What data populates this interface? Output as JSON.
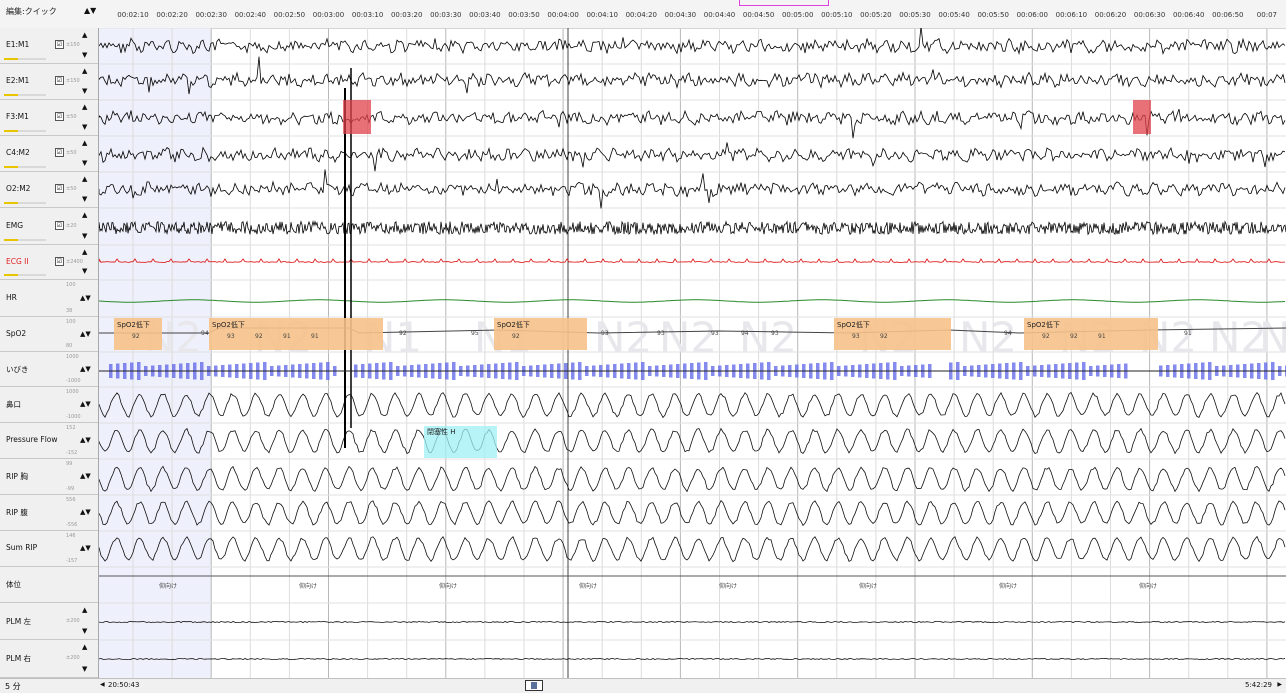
{
  "toolbar": {
    "edit_mode": "編集:クイック",
    "arrows": "▲▼"
  },
  "timeline": [
    "00:02:10",
    "00:02:20",
    "00:02:30",
    "00:02:40",
    "00:02:50",
    "00:03:00",
    "00:03:10",
    "00:03:20",
    "00:03:30",
    "00:03:40",
    "00:03:50",
    "00:04:00",
    "00:04:10",
    "00:04:20",
    "00:04:30",
    "00:04:40",
    "00:04:50",
    "00:05:00",
    "00:05:10",
    "00:05:20",
    "00:05:30",
    "00:05:40",
    "00:05:50",
    "00:06:00",
    "00:06:10",
    "00:06:20",
    "00:06:30",
    "00:06:40",
    "00:06:50",
    "00:07"
  ],
  "channels": [
    {
      "name": "E1:M1",
      "checked": "☑",
      "scale": "±150",
      "kind": "eeg",
      "color": "#000000"
    },
    {
      "name": "E2:M1",
      "checked": "☑",
      "scale": "±150",
      "kind": "eeg",
      "color": "#000000"
    },
    {
      "name": "F3:M1",
      "checked": "☑",
      "scale": "±50",
      "kind": "eeg",
      "color": "#000000"
    },
    {
      "name": "C4:M2",
      "checked": "☑",
      "scale": "±50",
      "kind": "eeg",
      "color": "#000000"
    },
    {
      "name": "O2:M2",
      "checked": "☑",
      "scale": "±50",
      "kind": "eeg",
      "color": "#000000"
    },
    {
      "name": "EMG",
      "checked": "☑",
      "scale": "±20",
      "kind": "emg",
      "color": "#000000"
    },
    {
      "name": "ECG II",
      "checked": "☑",
      "scale": "±2400",
      "kind": "ecg",
      "color": "#e02020"
    },
    {
      "name": "HR",
      "checked": "",
      "scale": "100",
      "scale_b": "",
      "scale_c": "38",
      "kind": "hr",
      "color": "#2a8a2a"
    },
    {
      "name": "SpO2",
      "checked": "",
      "scale": "100",
      "scale_b": "",
      "scale_c": "80",
      "kind": "spo2",
      "color": "#333333"
    },
    {
      "name": "いびき",
      "checked": "",
      "scale": "1000",
      "scale_b": "",
      "scale_c": "-1000",
      "kind": "snore",
      "color": "#3a3ae0"
    },
    {
      "name": "鼻口",
      "checked": "",
      "scale": "1000",
      "scale_b": "",
      "scale_c": "-1000",
      "kind": "resp",
      "color": "#111111"
    },
    {
      "name": "Pressure Flow",
      "checked": "",
      "scale": "152",
      "scale_b": "",
      "scale_c": "-152",
      "kind": "resp",
      "color": "#111111"
    },
    {
      "name": "RIP 胸",
      "checked": "",
      "scale": "99",
      "scale_b": "",
      "scale_c": "-99",
      "kind": "resp",
      "color": "#111111"
    },
    {
      "name": "RIP 腹",
      "checked": "",
      "scale": "556",
      "scale_b": "",
      "scale_c": "-556",
      "kind": "resp",
      "color": "#111111"
    },
    {
      "name": "Sum RIP",
      "checked": "",
      "scale": "146",
      "scale_b": "",
      "scale_c": "-157",
      "kind": "resp",
      "color": "#111111"
    },
    {
      "name": "体位",
      "checked": "",
      "scale": "",
      "kind": "pos",
      "color": "#222222"
    },
    {
      "name": "PLM 左",
      "checked": "",
      "scale": "±200",
      "kind": "plm",
      "color": "#111111"
    },
    {
      "name": "PLM 右",
      "checked": "",
      "scale": "±200",
      "kind": "plm",
      "color": "#111111"
    }
  ],
  "stages": [
    "N2",
    "N2",
    "N1",
    "N1",
    "N2",
    "N2",
    "N2",
    "N2",
    "N2",
    "N2",
    "N2",
    "N2",
    "N1"
  ],
  "spo2_events": [
    {
      "label": "SpO2低下",
      "values": [
        "92"
      ]
    },
    {
      "label": "SpO2低下",
      "values": [
        "93",
        "92",
        "91",
        "91"
      ]
    },
    {
      "label": "SpO2低下",
      "values": [
        "92"
      ]
    },
    {
      "label": "SpO2低下",
      "values": [
        "93",
        "92"
      ]
    },
    {
      "label": "SpO2低下",
      "values": [
        "92",
        "92",
        "91"
      ]
    }
  ],
  "spo2_values": [
    {
      "text": "94"
    },
    {
      "text": "92"
    },
    {
      "text": "95"
    },
    {
      "text": "93"
    },
    {
      "text": "93"
    },
    {
      "text": "93"
    },
    {
      "text": "94"
    },
    {
      "text": "93"
    },
    {
      "text": "94"
    },
    {
      "text": "91"
    }
  ],
  "apnea_event": {
    "label": "閉塞性 H"
  },
  "position_labels": [
    "仰向け",
    "仰向け",
    "仰向け",
    "仰向け",
    "仰向け",
    "仰向け",
    "仰向け",
    "仰向け"
  ],
  "status": {
    "epoch": "5 分",
    "start": "20:50:43",
    "end": "5:42:29"
  }
}
